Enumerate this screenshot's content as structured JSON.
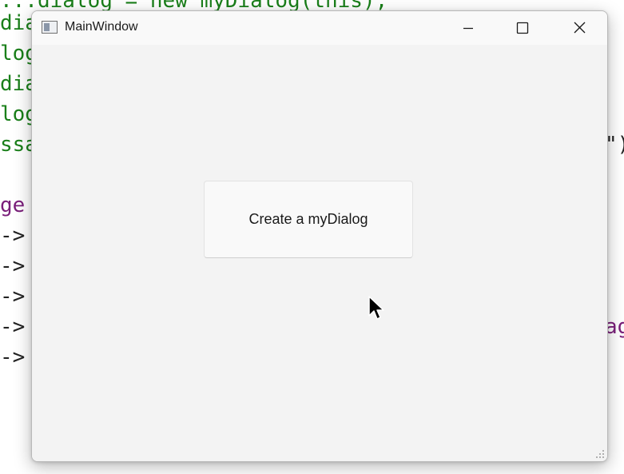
{
  "background_code": {
    "lines": [
      {
        "text": "dia",
        "color": "green"
      },
      {
        "text": "log",
        "color": "green"
      },
      {
        "text": "dia",
        "color": "green"
      },
      {
        "text": "log",
        "color": "green"
      },
      {
        "text": "ssa",
        "color": "green"
      },
      {
        "text": "ge",
        "color": "purple"
      },
      {
        "text": "->",
        "color": "black"
      },
      {
        "text": "->",
        "color": "black"
      },
      {
        "text": "->",
        "color": "black"
      },
      {
        "text": "->",
        "color": "black"
      },
      {
        "text": "->",
        "color": "black"
      }
    ],
    "top_partial": "...dialog = new myDialog(this);",
    "right_fragments": [
      "\")",
      "ag"
    ]
  },
  "window": {
    "title": "MainWindow",
    "icon": "app-window-icon",
    "controls": {
      "minimize": "minimize-icon",
      "maximize": "maximize-icon",
      "close": "close-icon"
    }
  },
  "main": {
    "create_button_label": "Create a myDialog"
  },
  "colors": {
    "window_bg": "#f3f3f3",
    "titlebar_bg": "#f9f9f9",
    "code_green": "#1a7f1a",
    "code_purple": "#7a1f7a"
  }
}
